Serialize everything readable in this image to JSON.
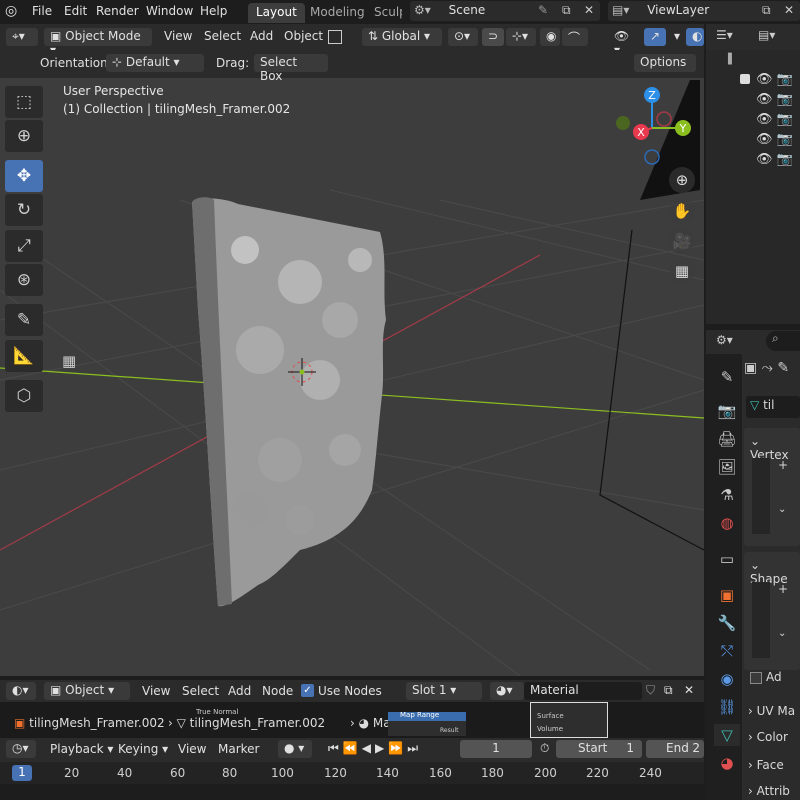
{
  "menu": {
    "file": "File",
    "edit": "Edit",
    "render": "Render",
    "window": "Window",
    "help": "Help"
  },
  "workspaces": {
    "layout": "Layout",
    "modeling": "Modeling",
    "sculpt": "Sculp"
  },
  "scene": "Scene",
  "view_layer": "ViewLayer",
  "header": {
    "mode": "Object Mode",
    "view": "View",
    "select": "Select",
    "add": "Add",
    "object": "Object",
    "orientation": "Global"
  },
  "tool_options": {
    "orientation_label": "Orientation:",
    "orientation_value": "Default",
    "drag_label": "Drag:",
    "drag_value": "Select Box",
    "options": "Options"
  },
  "viewport": {
    "perspective": "User Perspective",
    "collection": "(1) Collection | tilingMesh_Framer.002"
  },
  "gizmo": {
    "z": "Z",
    "x": "X",
    "y": "Y"
  },
  "properties": {
    "object_name": "til",
    "vertex_groups": "Vertex",
    "shape_keys": "Shape",
    "add": "Ad",
    "uv_maps": "UV Ma",
    "color": "Color",
    "face": "Face",
    "attributes": "Attrib"
  },
  "node_editor": {
    "object": "Object",
    "view": "View",
    "select": "Select",
    "add": "Add",
    "node": "Node",
    "use_nodes": "Use Nodes",
    "slot": "Slot 1",
    "material": "Material",
    "breadcrumb_object": "tilingMesh_Framer.002",
    "breadcrumb_mesh": "tilingMesh_Framer.002",
    "breadcrumb_material": "Material",
    "node_true_normal": "True Normal",
    "node_map_range": "Map Range",
    "node_surface": "Surface",
    "node_volume": "Volume",
    "node_result": "Result"
  },
  "timeline": {
    "playback": "Playback",
    "keying": "Keying",
    "view": "View",
    "marker": "Marker",
    "current_frame": "1",
    "start_label": "Start",
    "start_value": "1",
    "end_label": "End",
    "end_value": "2",
    "frame_marker": "1",
    "ticks": [
      "20",
      "40",
      "60",
      "80",
      "100",
      "120",
      "140",
      "160",
      "180",
      "200",
      "220",
      "240"
    ]
  },
  "colors": {
    "accent": "#4772b3",
    "x_axis": "#e8394f",
    "y_axis": "#8bbf1f",
    "z_axis": "#2c8fe8"
  }
}
